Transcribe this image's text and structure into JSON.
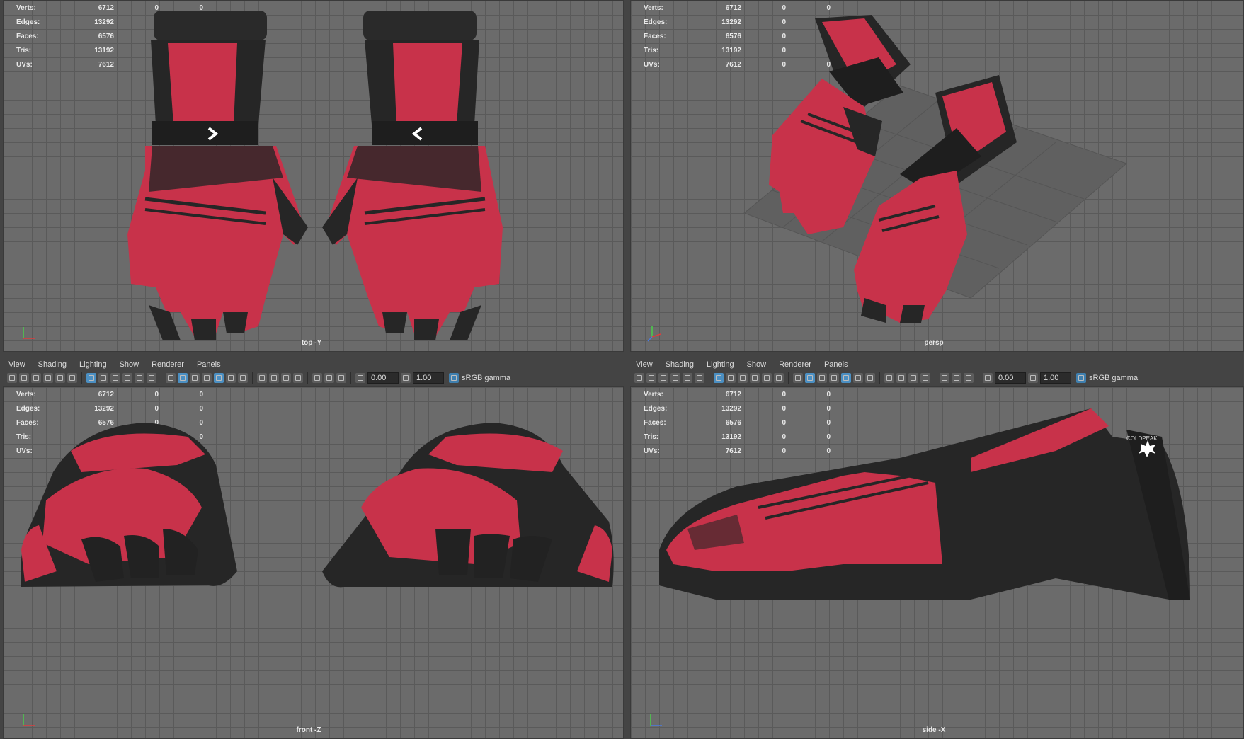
{
  "stats": {
    "rows": [
      {
        "label": "Verts:",
        "count": "6712",
        "selected": "0",
        "components": "0"
      },
      {
        "label": "Edges:",
        "count": "13292",
        "selected": "0",
        "components": "0"
      },
      {
        "label": "Faces:",
        "count": "6576",
        "selected": "0",
        "components": "0"
      },
      {
        "label": "Tris:",
        "count": "13192",
        "selected": "0",
        "components": "0"
      },
      {
        "label": "UVs:",
        "count": "7612",
        "selected": "0",
        "components": "0"
      }
    ]
  },
  "viewports": {
    "top": {
      "camera": "top -Y"
    },
    "persp": {
      "camera": "persp"
    },
    "front": {
      "camera": "front -Z"
    },
    "side": {
      "camera": "side -X"
    }
  },
  "panel_menu": {
    "view": "View",
    "shading": "Shading",
    "lighting": "Lighting",
    "show": "Show",
    "renderer": "Renderer",
    "panels": "Panels"
  },
  "panel_toolbar": {
    "exposure": "0.00",
    "gamma": "1.00",
    "color_space": "sRGB gamma"
  },
  "model_label": "COLDPEAK",
  "colors": {
    "glove_red": "#c8324a",
    "glove_dark": "#262626",
    "viewport_bg": "#6b6b6b",
    "grid_line": "#5a5a5a",
    "toolbar_accent": "#4b8fc2"
  }
}
